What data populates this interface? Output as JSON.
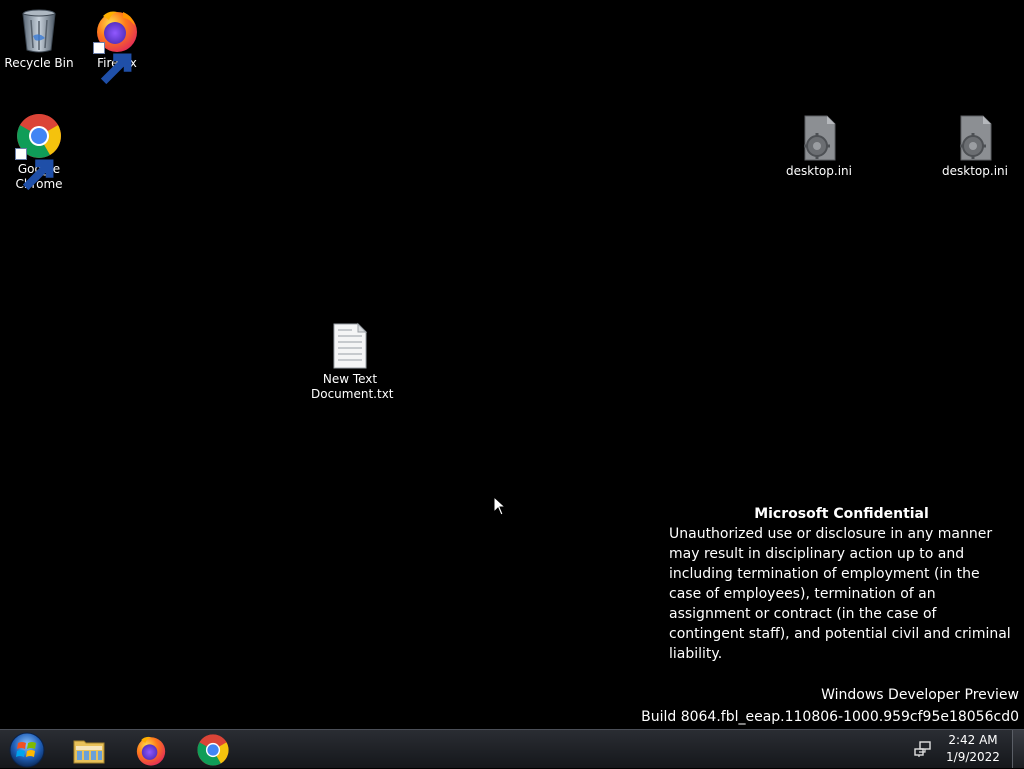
{
  "desktop": {
    "icons": [
      {
        "label": "Recycle Bin",
        "icon": "recycle-bin-icon"
      },
      {
        "label": "Firefox",
        "icon": "firefox-icon",
        "shortcut": true
      },
      {
        "label": "Google\nChrome",
        "icon": "chrome-icon",
        "shortcut": true
      },
      {
        "label": "desktop.ini",
        "icon": "settings-file-icon"
      },
      {
        "label": "desktop.ini",
        "icon": "settings-file-icon"
      },
      {
        "label": "New Text\nDocument.txt",
        "icon": "text-file-icon"
      }
    ]
  },
  "watermark": {
    "title": "Microsoft Confidential",
    "body": "Unauthorized use or disclosure in any manner may result in disciplinary action up to and including termination of employment (in the case of employees), termination of an assignment or contract (in the case of contingent staff), and potential civil and criminal liability."
  },
  "build": {
    "line1": "Windows Developer Preview",
    "line2": "Build 8064.fbl_eeap.110806-1000.959cf95e18056cd0"
  },
  "taskbar": {
    "pinned": [
      {
        "icon": "windows-start-icon"
      },
      {
        "icon": "file-explorer-icon"
      },
      {
        "icon": "firefox-icon"
      },
      {
        "icon": "chrome-icon"
      }
    ],
    "tray": {
      "network_icon": "network-icon",
      "time": "2:42 AM",
      "date": "1/9/2022"
    }
  },
  "colors": {
    "desktop_bg": "#000000",
    "taskbar_bg": "#1e2024",
    "text": "#ffffff"
  }
}
